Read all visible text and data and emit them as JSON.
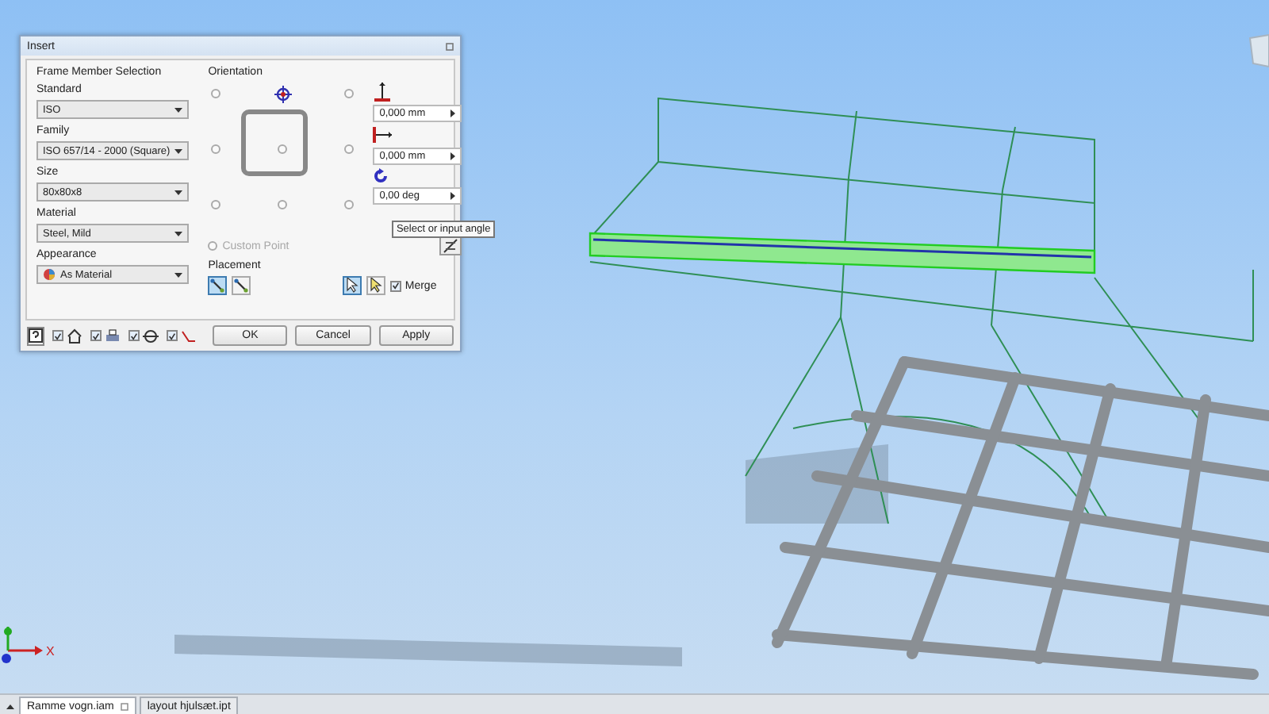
{
  "dialog": {
    "title": "Insert",
    "frame_member_selection": {
      "heading": "Frame Member Selection",
      "fields": [
        {
          "label": "Standard",
          "value": "ISO",
          "kind": "plain"
        },
        {
          "label": "Family",
          "value": "ISO 657/14 - 2000 (Square)",
          "kind": "plain"
        },
        {
          "label": "Size",
          "value": "80x80x8",
          "kind": "plain"
        },
        {
          "label": "Material",
          "value": "Steel, Mild",
          "kind": "plain"
        },
        {
          "label": "Appearance",
          "value": "As Material",
          "kind": "appearance"
        }
      ]
    },
    "orientation": {
      "heading": "Orientation",
      "anchor_points": [
        {
          "selected": false
        },
        {
          "selected": true
        },
        {
          "selected": false
        },
        {
          "selected": false
        },
        {
          "selected": false
        },
        {
          "selected": false
        },
        {
          "selected": false
        },
        {
          "selected": false
        },
        {
          "selected": false
        }
      ],
      "custom_point": {
        "label": "Custom Point",
        "disabled": true,
        "selected": false
      },
      "offsets": [
        {
          "kind": "vertical",
          "value": "0,000 mm"
        },
        {
          "kind": "horizontal",
          "value": "0,000 mm"
        },
        {
          "kind": "rotation",
          "value": "0,00 deg"
        }
      ],
      "tooltip": "Select or input angle"
    },
    "placement": {
      "heading": "Placement",
      "mode_buttons": [
        {
          "selected": true
        },
        {
          "selected": false
        }
      ],
      "select_buttons": [
        {
          "selected": true
        },
        {
          "selected": false
        }
      ],
      "merge": {
        "label": "Merge",
        "checked": true
      }
    },
    "toolbar_checks": [
      {
        "checked": true
      },
      {
        "checked": true
      },
      {
        "checked": true
      },
      {
        "checked": true
      }
    ],
    "buttons": [
      "OK",
      "Cancel",
      "Apply"
    ]
  },
  "viewport": {
    "axis_label": "X"
  },
  "document_tabs": [
    {
      "label": "Ramme vogn.iam",
      "selected": true
    },
    {
      "label": "layout hjulsæt.ipt",
      "selected": false
    }
  ]
}
